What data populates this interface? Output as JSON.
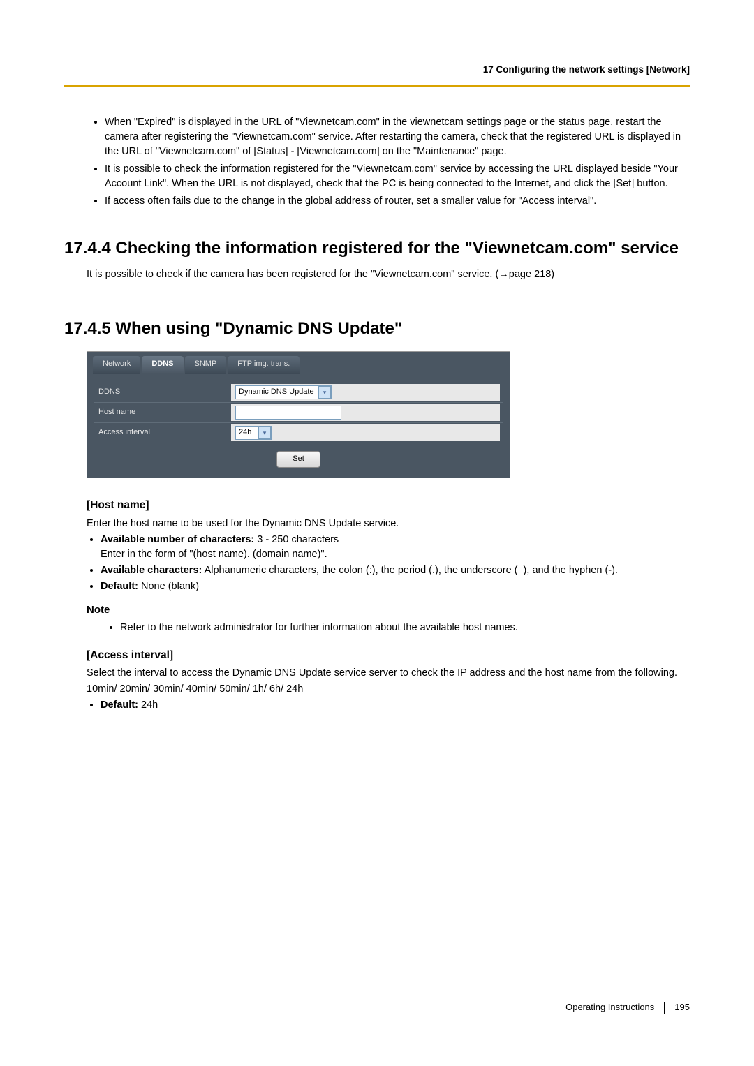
{
  "header": {
    "section_path": "17 Configuring the network settings [Network]"
  },
  "intro_bullets": [
    "When \"Expired\" is displayed in the URL of \"Viewnetcam.com\" in the viewnetcam settings page or the status page, restart the camera after registering the \"Viewnetcam.com\" service. After restarting the camera, check that the registered URL is displayed in the URL of \"Viewnetcam.com\" of [Status] - [Viewnetcam.com] on the \"Maintenance\" page.",
    "It is possible to check the information registered for the \"Viewnetcam.com\" service by accessing the URL displayed beside \"Your Account Link\". When the URL is not displayed, check that the PC is being connected to the Internet, and click the [Set] button.",
    "If access often fails due to the change in the global address of router, set a smaller value for \"Access interval\"."
  ],
  "section_1744": {
    "title": "17.4.4  Checking the information registered for the \"Viewnetcam.com\" service",
    "body_prefix": "It is possible to check if the camera has been registered for the \"Viewnetcam.com\" service. (",
    "body_link": "page 218",
    "body_suffix": ")"
  },
  "section_1745": {
    "title": "17.4.5  When using \"Dynamic DNS Update\""
  },
  "screenshot": {
    "tabs": [
      "Network",
      "DDNS",
      "SNMP",
      "FTP img. trans."
    ],
    "active_tab_index": 1,
    "rows": [
      {
        "label": "DDNS",
        "type": "dropdown",
        "value": "Dynamic DNS Update"
      },
      {
        "label": "Host name",
        "type": "text",
        "value": ""
      },
      {
        "label": "Access interval",
        "type": "dropdown",
        "value": "24h"
      }
    ],
    "set_button": "Set"
  },
  "host_name": {
    "head": "[Host name]",
    "intro": "Enter the host name to be used for the Dynamic DNS Update service.",
    "items": [
      {
        "bold": "Available number of characters:",
        "rest": " 3 - 250 characters",
        "sub": "Enter in the form of \"(host name). (domain name)\"."
      },
      {
        "bold": "Available characters:",
        "rest": " Alphanumeric characters, the colon (:), the period (.), the underscore (_), and the hyphen (-).",
        "sub": ""
      },
      {
        "bold": "Default:",
        "rest": " None (blank)",
        "sub": ""
      }
    ]
  },
  "note": {
    "head": "Note",
    "items": [
      "Refer to the network administrator for further information about the available host names."
    ]
  },
  "access_interval": {
    "head": "[Access interval]",
    "intro": "Select the interval to access the Dynamic DNS Update service server to check the IP address and the host name from the following.",
    "options": "10min/ 20min/ 30min/ 40min/ 50min/ 1h/ 6h/ 24h",
    "default_bold": "Default:",
    "default_rest": " 24h"
  },
  "footer": {
    "doc": "Operating Instructions",
    "page": "195"
  }
}
